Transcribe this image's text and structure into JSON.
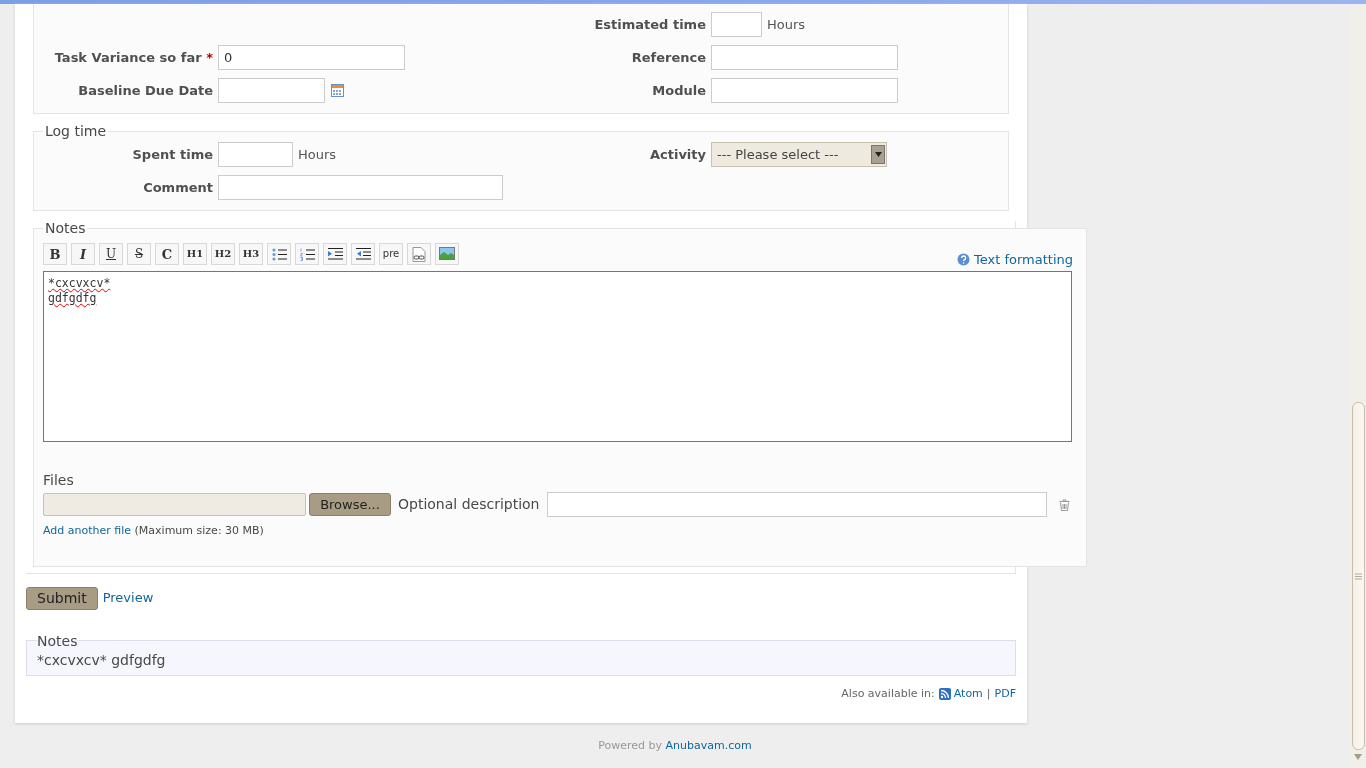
{
  "details": {
    "rows": [
      {
        "left": null,
        "right": {
          "label": "Estimated time",
          "kind": "hours",
          "suffix": "Hours"
        }
      },
      {
        "left": {
          "label": "Task Variance so far",
          "required_mark": "*",
          "kind": "text",
          "value": "0"
        },
        "right": {
          "label": "Reference",
          "kind": "text"
        }
      },
      {
        "left": {
          "label": "Baseline Due Date",
          "kind": "date"
        },
        "right": {
          "label": "Module",
          "kind": "text"
        }
      }
    ]
  },
  "log_time": {
    "legend": "Log time",
    "rows": [
      {
        "left": {
          "label": "Spent time",
          "kind": "hours",
          "suffix": "Hours"
        },
        "right": {
          "label": "Activity",
          "kind": "select",
          "value": "--- Please select ---"
        }
      },
      {
        "left": {
          "label": "Comment",
          "kind": "comment"
        },
        "right": null
      }
    ]
  },
  "notes": {
    "legend": "Notes",
    "toolbar": [
      {
        "kind": "bold",
        "label": "B"
      },
      {
        "kind": "italic",
        "label": "I"
      },
      {
        "kind": "underline",
        "label": "U"
      },
      {
        "kind": "strike",
        "label": "S"
      },
      {
        "kind": "code",
        "label": "C"
      },
      {
        "kind": "heading",
        "label": "H1"
      },
      {
        "kind": "heading",
        "label": "H2"
      },
      {
        "kind": "heading",
        "label": "H3"
      },
      {
        "kind": "ul"
      },
      {
        "kind": "ol"
      },
      {
        "kind": "indent"
      },
      {
        "kind": "outdent"
      },
      {
        "kind": "pre",
        "label": "pre"
      },
      {
        "kind": "link"
      },
      {
        "kind": "image"
      }
    ],
    "help_link": "Text formatting",
    "text_lines": [
      "*cxcvxcv*",
      "gdfgdfg"
    ],
    "files": {
      "label": "Files",
      "browse": "Browse...",
      "description_label": "Optional description",
      "add_link": "Add another file",
      "max_size": "(Maximum size: 30 MB)"
    }
  },
  "actions": {
    "submit": "Submit",
    "preview": "Preview"
  },
  "preview": {
    "legend": "Notes",
    "text": "*cxcvxcv* gdfgdfg"
  },
  "other_formats": {
    "label": "Also available in:",
    "links": [
      "Atom",
      "PDF"
    ],
    "separator": "|"
  },
  "footer": {
    "label": "Powered by",
    "link": "Anubavam.com"
  }
}
